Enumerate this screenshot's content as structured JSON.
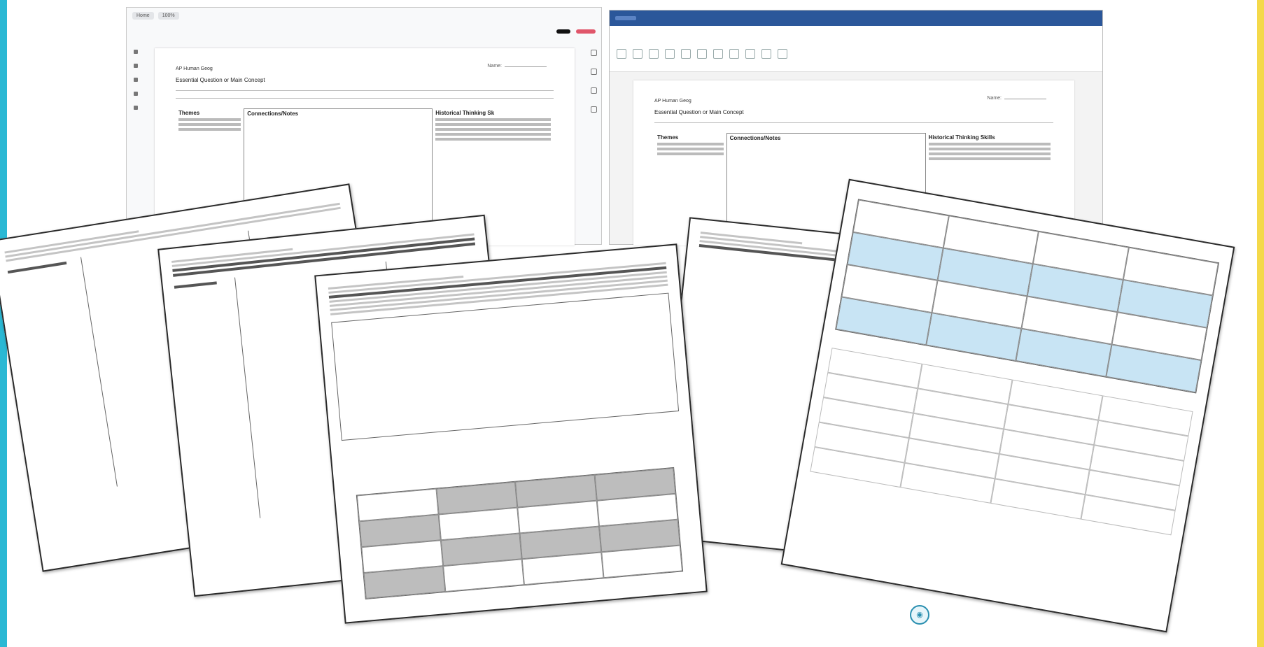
{
  "gdocs": {
    "toolbar_pills": [
      "Home",
      "100%"
    ],
    "share_label": "",
    "doc": {
      "course": "AP Human Geog",
      "title": "Essential Question or Main Concept",
      "name_label": "Name:",
      "col1_heading": "Themes",
      "col2_heading": "Connections/Notes",
      "col3_heading": "Historical Thinking Sk"
    }
  },
  "word": {
    "doc": {
      "course": "AP Human Geog",
      "title": "Essential Question or Main Concept",
      "name_label": "Name:",
      "col1_heading": "Themes",
      "col2_heading": "Connections/Notes",
      "col3_heading": "Historical Thinking Skills"
    }
  },
  "sheets": {
    "s3_grid_title": "",
    "s5_grid_title": "",
    "s5_second_title": ""
  },
  "colors": {
    "left_border": "#2ab8d4",
    "right_border": "#f4d94a",
    "word_titlebar": "#2b579a",
    "gdocs_red_button": "#e0566a",
    "table_blue": "#c8e4f4",
    "table_grey": "#bdbdbd"
  },
  "icons": {
    "badge": "logo-badge-icon"
  }
}
